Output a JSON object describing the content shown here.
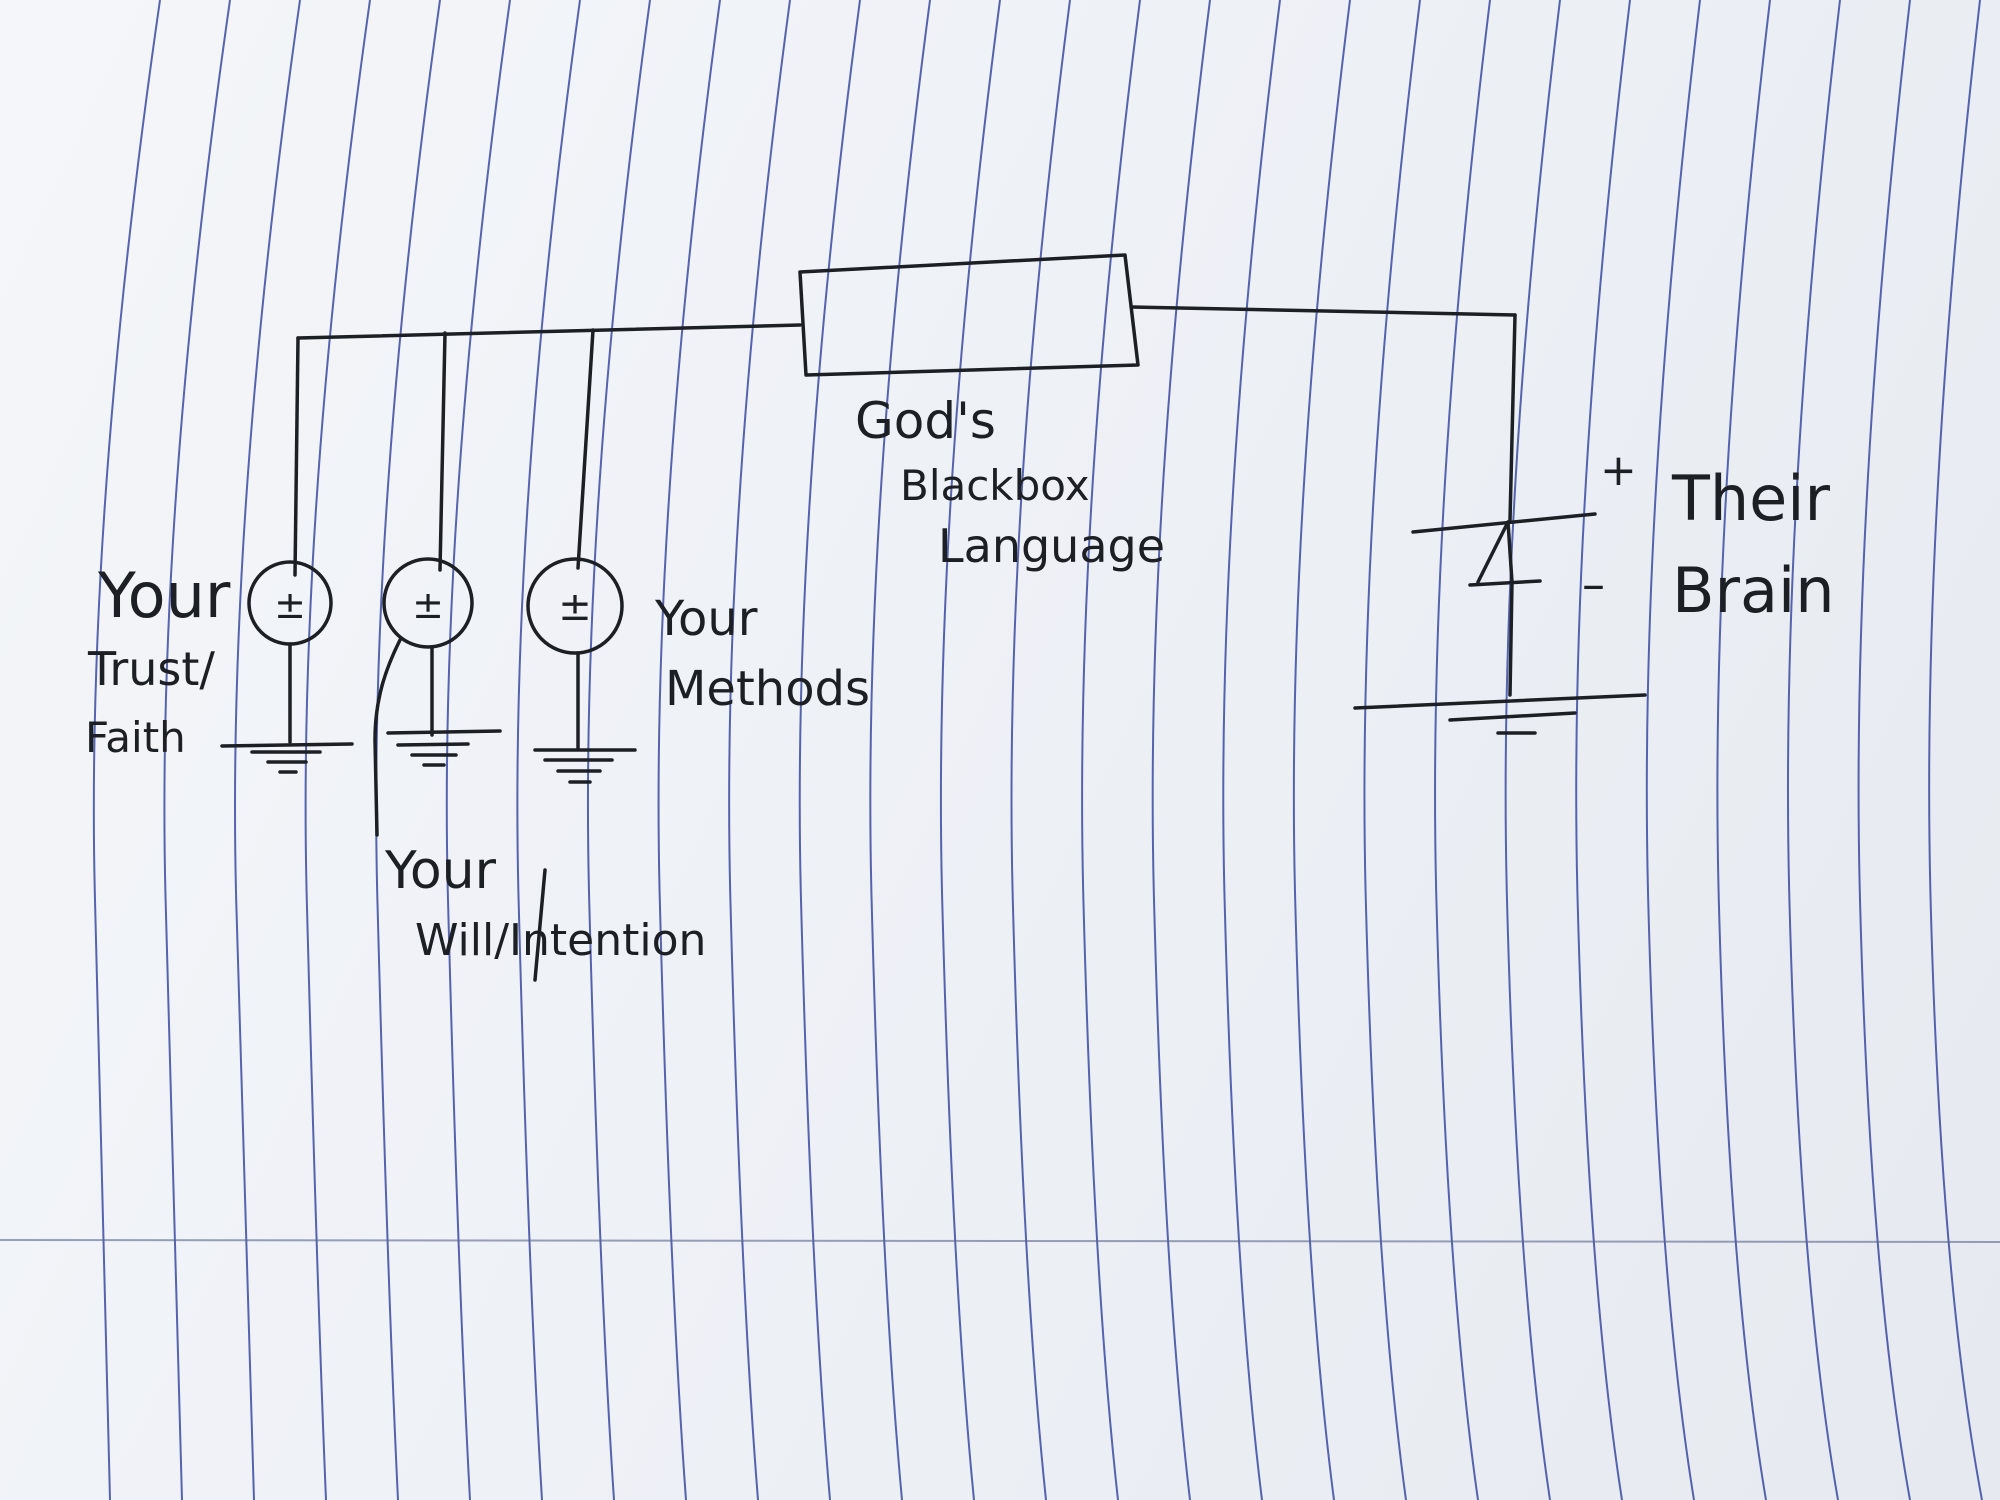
{
  "labels": {
    "sources": [
      {
        "line1": "Your",
        "line2": "Trust/",
        "line3": "Faith"
      },
      {
        "line1": "Your",
        "line2": "Will/Intention"
      },
      {
        "line1": "Your",
        "line2": "Methods"
      }
    ],
    "source_symbol": "±",
    "box": {
      "line1": "God's",
      "line2": "Blackbox",
      "line3": "Language"
    },
    "diode": {
      "plus": "+",
      "minus": "–",
      "line1": "Their",
      "line2": "Brain"
    }
  },
  "colors": {
    "ink": "#1c2024",
    "rule_line": "#3a4aa0",
    "paper": "#eef1f6"
  }
}
